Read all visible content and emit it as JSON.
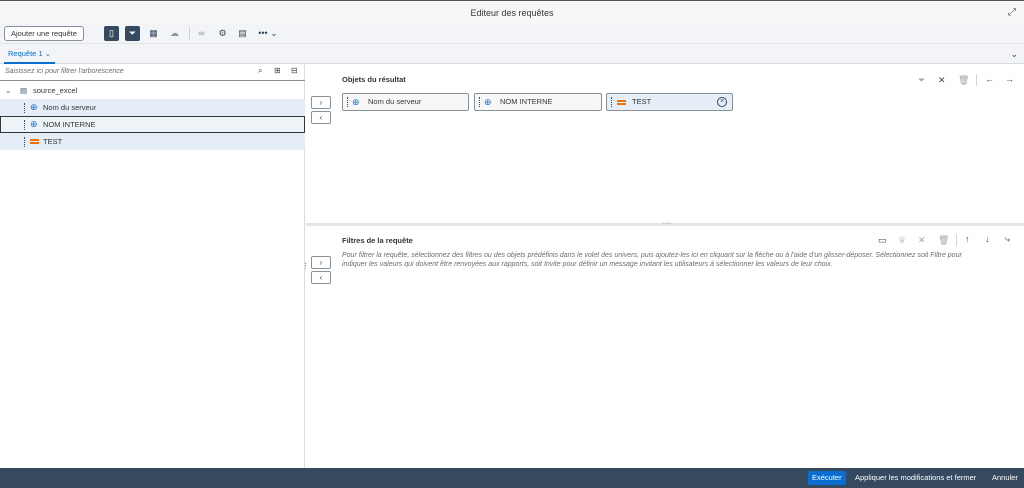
{
  "window": {
    "title": "Editeur des requêtes"
  },
  "toolbar": {
    "add_query_label": "Ajouter une requête"
  },
  "tabs": [
    {
      "label": "Requête 1"
    }
  ],
  "tree": {
    "search_placeholder": "Saisissez ici pour filtrer l'arborescence",
    "root": "source_excel",
    "items": [
      {
        "label": "Nom du serveur",
        "type": "dimension"
      },
      {
        "label": "NOM INTERNE",
        "type": "dimension"
      },
      {
        "label": "TEST",
        "type": "measure"
      }
    ]
  },
  "result_objects": {
    "title": "Objets du résultat",
    "tokens": [
      {
        "label": "Nom du serveur",
        "type": "dimension"
      },
      {
        "label": "NOM INTERNE",
        "type": "dimension"
      },
      {
        "label": "TEST",
        "type": "measure"
      }
    ]
  },
  "filters": {
    "title": "Filtres de la requête",
    "hint": "Pour filtrer la requête, sélectionnez des filtres ou des objets prédéfinis dans le volet des univers, puis ajoutez-les ici en cliquant sur la flèche ou à l'aide d'un glisser-déposer. Sélectionnez soit Filtre pour indiquer les valeurs qui doivent être renvoyées aux rapports, soit Invite pour définir un message invitant les utilisateurs à sélectionner les valeurs de leur choix."
  },
  "footer": {
    "run_label": "Exécuter",
    "apply_label": "Appliquer les modifications et fermer",
    "cancel_label": "Annuler"
  },
  "colors": {
    "accent": "#0a6ed1",
    "shell": "#354a5f",
    "measure": "#e9730c"
  }
}
